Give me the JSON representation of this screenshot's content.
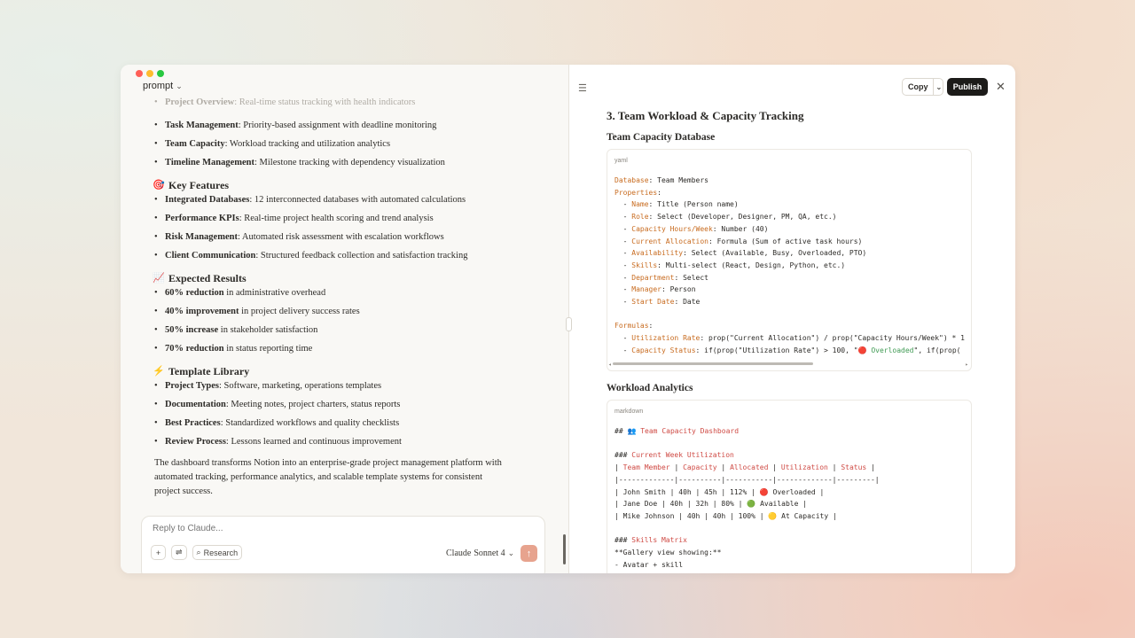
{
  "window": {
    "title": "prompt"
  },
  "chat": {
    "faded_line": {
      "bold": "Project Overview",
      "rest": ": Real-time status tracking with health indicators"
    },
    "top_bullets": [
      {
        "bold": "Task Management",
        "rest": ": Priority-based assignment with deadline monitoring"
      },
      {
        "bold": "Team Capacity",
        "rest": ": Workload tracking and utilization analytics"
      },
      {
        "bold": "Timeline Management",
        "rest": ": Milestone tracking with dependency visualization"
      }
    ],
    "sections": [
      {
        "icon": "🎯",
        "title": "Key Features",
        "items": [
          {
            "bold": "Integrated Databases",
            "rest": ": 12 interconnected databases with automated calculations"
          },
          {
            "bold": "Performance KPIs",
            "rest": ": Real-time project health scoring and trend analysis"
          },
          {
            "bold": "Risk Management",
            "rest": ": Automated risk assessment with escalation workflows"
          },
          {
            "bold": "Client Communication",
            "rest": ": Structured feedback collection and satisfaction tracking"
          }
        ]
      },
      {
        "icon": "📈",
        "title": "Expected Results",
        "items": [
          {
            "bold": "60% reduction",
            "rest": " in administrative overhead"
          },
          {
            "bold": "40% improvement",
            "rest": " in project delivery success rates"
          },
          {
            "bold": "50% increase",
            "rest": " in stakeholder satisfaction"
          },
          {
            "bold": "70% reduction",
            "rest": " in status reporting time"
          }
        ]
      },
      {
        "icon": "⚡",
        "title": "Template Library",
        "items": [
          {
            "bold": "Project Types",
            "rest": ": Software, marketing, operations templates"
          },
          {
            "bold": "Documentation",
            "rest": ": Meeting notes, project charters, status reports"
          },
          {
            "bold": "Best Practices",
            "rest": ": Standardized workflows and quality checklists"
          },
          {
            "bold": "Review Process",
            "rest": ": Lessons learned and continuous improvement"
          }
        ]
      }
    ],
    "closing": "The dashboard transforms Notion into an enterprise-grade project management platform with automated tracking, performance analytics, and scalable template systems for consistent project success."
  },
  "composer": {
    "placeholder": "Reply to Claude...",
    "add_icon": "plus-icon",
    "tools_icon": "sliders-icon",
    "research_label": "Research",
    "model_name": "Claude",
    "model_version": "Sonnet 4",
    "send_icon": "arrow-up-icon"
  },
  "artifact": {
    "copy_label": "Copy",
    "publish_label": "Publish",
    "section_title": "3. Team Workload & Capacity Tracking",
    "sub1": "Team Capacity Database",
    "code1_lang": "yaml",
    "sub2": "Workload Analytics",
    "code2_lang": "markdown"
  },
  "code1": [
    [
      {
        "t": "Database",
        "c": "k"
      },
      {
        "t": ": Team Members"
      }
    ],
    [
      {
        "t": "Properties",
        "c": "k"
      },
      {
        "t": ":"
      }
    ],
    [
      {
        "t": "  - "
      },
      {
        "t": "Name",
        "c": "k"
      },
      {
        "t": ": Title (Person name)"
      }
    ],
    [
      {
        "t": "  - "
      },
      {
        "t": "Role",
        "c": "k"
      },
      {
        "t": ": Select (Developer, Designer, PM, QA, etc.)"
      }
    ],
    [
      {
        "t": "  - "
      },
      {
        "t": "Capacity Hours/Week",
        "c": "k"
      },
      {
        "t": ": Number (40)"
      }
    ],
    [
      {
        "t": "  - "
      },
      {
        "t": "Current Allocation",
        "c": "k"
      },
      {
        "t": ": Formula (Sum of active task hours)"
      }
    ],
    [
      {
        "t": "  - "
      },
      {
        "t": "Availability",
        "c": "k"
      },
      {
        "t": ": Select (Available, Busy, Overloaded, PTO)"
      }
    ],
    [
      {
        "t": "  - "
      },
      {
        "t": "Skills",
        "c": "k"
      },
      {
        "t": ": Multi-select (React, Design, Python, etc.)"
      }
    ],
    [
      {
        "t": "  - "
      },
      {
        "t": "Department",
        "c": "k"
      },
      {
        "t": ": Select"
      }
    ],
    [
      {
        "t": "  - "
      },
      {
        "t": "Manager",
        "c": "k"
      },
      {
        "t": ": Person"
      }
    ],
    [
      {
        "t": "  - "
      },
      {
        "t": "Start Date",
        "c": "k"
      },
      {
        "t": ": Date"
      }
    ],
    [
      {
        "t": ""
      }
    ],
    [
      {
        "t": "Formulas",
        "c": "k"
      },
      {
        "t": ":"
      }
    ],
    [
      {
        "t": "  - "
      },
      {
        "t": "Utilization Rate",
        "c": "k"
      },
      {
        "t": ": prop(\"Current Allocation\") / prop(\"Capacity Hours/Week\") * 1"
      }
    ],
    [
      {
        "t": "  - "
      },
      {
        "t": "Capacity Status",
        "c": "k"
      },
      {
        "t": ": if(prop(\"Utilization Rate\") > 100, \""
      },
      {
        "t": "🔴 Overloaded",
        "c": "g"
      },
      {
        "t": "\", if(prop("
      }
    ]
  ],
  "code2": [
    [
      {
        "t": "## 👥 "
      },
      {
        "t": "Team Capacity Dashboard",
        "c": "r"
      }
    ],
    [
      {
        "t": ""
      }
    ],
    [
      {
        "t": "### "
      },
      {
        "t": "Current Week Utilization",
        "c": "r"
      }
    ],
    [
      {
        "t": "| "
      },
      {
        "t": "Team Member",
        "c": "r"
      },
      {
        "t": " | "
      },
      {
        "t": "Capacity",
        "c": "r"
      },
      {
        "t": " | "
      },
      {
        "t": "Allocated",
        "c": "r"
      },
      {
        "t": " | "
      },
      {
        "t": "Utilization",
        "c": "r"
      },
      {
        "t": " | "
      },
      {
        "t": "Status",
        "c": "r"
      },
      {
        "t": " |"
      }
    ],
    [
      {
        "t": "|-------------|----------|-----------|-------------|---------|"
      }
    ],
    [
      {
        "t": "| John Smith | 40h | 45h | 112% | 🔴 Overloaded |"
      }
    ],
    [
      {
        "t": "| Jane Doe | 40h | 32h | 80% | 🟢 Available |"
      }
    ],
    [
      {
        "t": "| Mike Johnson | 40h | 40h | 100% | 🟡 At Capacity |"
      }
    ],
    [
      {
        "t": ""
      }
    ],
    [
      {
        "t": "### "
      },
      {
        "t": "Skills Matrix",
        "c": "r"
      }
    ],
    [
      {
        "t": "**Gallery view showing:**"
      }
    ],
    [
      {
        "t": "- Avatar + skill"
      }
    ]
  ]
}
